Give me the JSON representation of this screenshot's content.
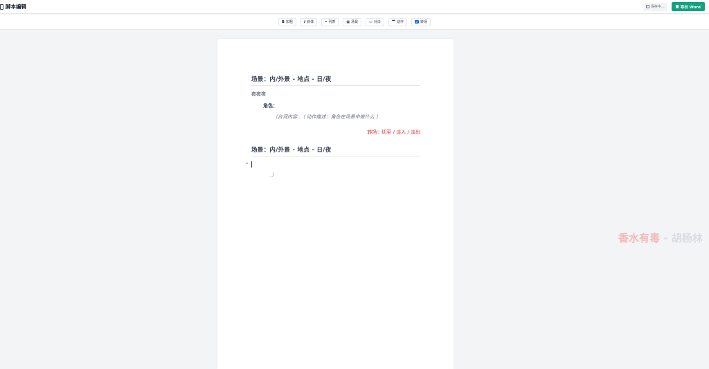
{
  "app": {
    "title": "脚本编辑"
  },
  "header": {
    "save_status": "保存中...",
    "export_label": "导出 Word"
  },
  "toolbar": {
    "buttons": [
      {
        "icon": "B",
        "label": "加粗"
      },
      {
        "icon": "I",
        "label": "斜体"
      },
      {
        "icon": "•",
        "label": "列表"
      },
      {
        "icon": "▦",
        "label": "场景"
      },
      {
        "icon": "▭",
        "label": "对白"
      },
      {
        "icon": "⺮",
        "label": "动作"
      },
      {
        "icon": "⇄",
        "label": "转场"
      }
    ]
  },
  "document": {
    "scene1_heading": "场景：内/外景 - 地点 - 日/夜",
    "action1": "夜夜夜",
    "character": "角色：",
    "parenthetical": "（台词内容..（ 动作描述：角色在场景中做什么 ）",
    "transition": "转场：切至 / 淡入 / 淡出",
    "scene2_heading": "场景：内/外景 - 地点 - 日/夜",
    "bullet": "•",
    "parenthetical2": ".）"
  },
  "watermark": {
    "text": "香水有毒",
    "separator": " - ",
    "author": "胡杨林"
  }
}
